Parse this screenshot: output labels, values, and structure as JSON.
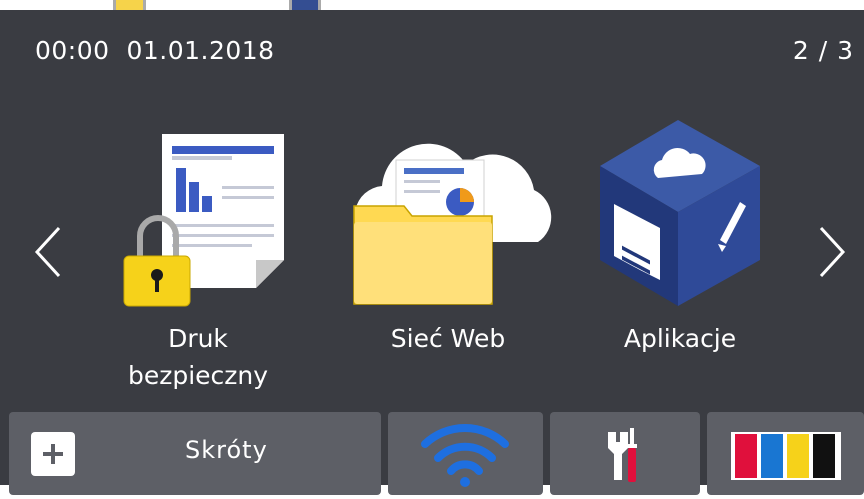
{
  "status_bar": {
    "time": "00:00",
    "date": "01.01.2018",
    "page_indicator": "2 / 3"
  },
  "tiles": [
    {
      "label_line1": "Druk",
      "label_line2": "bezpieczny",
      "icon": "secure-print-lock-icon"
    },
    {
      "label": "Sieć Web",
      "icon": "web-cloud-folder-icon"
    },
    {
      "label": "Aplikacje",
      "icon": "apps-cube-icon"
    }
  ],
  "bottom_bar": {
    "shortcuts_label": "Skróty",
    "shortcuts_icon": "plus-icon",
    "wifi_icon": "wifi-icon",
    "settings_icon": "tools-icon",
    "toner_icon": "toner-cmyk-icon"
  },
  "colors": {
    "screen_background": "#3a3c42",
    "button_background": "#5d5f66",
    "wifi_blue": "#1e6fe0",
    "toner_magenta": "#e0103c",
    "toner_cyan": "#1976d2",
    "toner_yellow": "#f6d21a",
    "toner_black": "#111111"
  }
}
